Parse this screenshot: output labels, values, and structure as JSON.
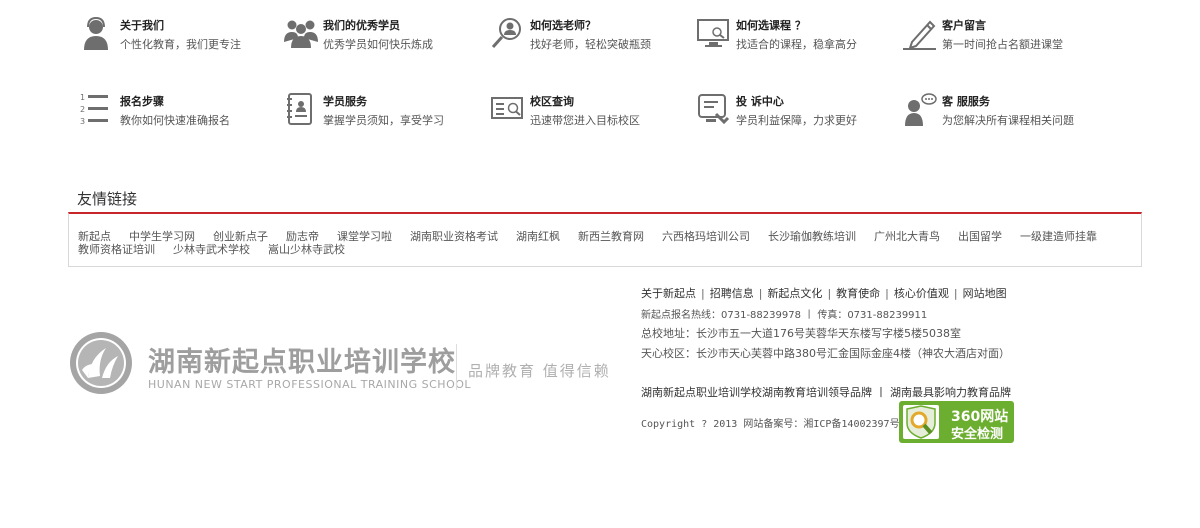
{
  "features": [
    {
      "title": "关于我们",
      "desc": "个性化教育，我们更专注",
      "icon": "person-icon"
    },
    {
      "title": "我们的优秀学员",
      "desc": "优秀学员如何快乐炼成",
      "icon": "group-icon"
    },
    {
      "title": "如何选老师？",
      "desc": "找好老师，轻松突破瓶颈",
      "icon": "teacher-search-icon"
    },
    {
      "title": "如何选课程 ？",
      "desc": "找适合的课程，稳拿高分",
      "icon": "monitor-icon"
    },
    {
      "title": "客户留言",
      "desc": "第一时间抢占名额进课堂",
      "icon": "pen-icon"
    },
    {
      "title": "报名步骤",
      "desc": "教你如何快速准确报名",
      "icon": "steps-list-icon"
    },
    {
      "title": "学员服务",
      "desc": "掌握学员须知，享受学习",
      "icon": "notebook-icon"
    },
    {
      "title": "校区查询",
      "desc": "迅速带您进入目标校区",
      "icon": "campus-search-icon"
    },
    {
      "title": "投 诉中心",
      "desc": "学员利益保障，力求更好",
      "icon": "complaint-icon"
    },
    {
      "title": "客 服服务",
      "desc": "为您解决所有课程相关问题",
      "icon": "customer-service-icon"
    }
  ],
  "friend_links": {
    "title": "友情链接",
    "items": [
      "新起点",
      "中学生学习网",
      "创业新点子",
      "励志帝",
      "课堂学习啦",
      "湖南职业资格考试",
      "湖南红枫",
      "新西兰教育网",
      "六西格玛培训公司",
      "长沙瑜伽教练培训",
      "广州北大青鸟",
      "出国留学",
      "一级建造师挂靠",
      "教师资格证培训",
      "少林寺武术学校",
      "嵩山少林寺武校"
    ]
  },
  "logo": {
    "cn": "湖南新起点职业培训学校",
    "en": "HUNAN NEW START PROFESSIONAL TRAINING SCHOOL",
    "slogan": "品牌教育 值得信赖"
  },
  "footer": {
    "nav": [
      "关于新起点",
      "招聘信息",
      "新起点文化",
      "教育使命",
      "核心价值观",
      "网站地图"
    ],
    "hotline": "新起点报名热线：0731-88239978 丨 传真：0731-88239911",
    "main_campus": "总校地址：长沙市五一大道176号芙蓉华天东楼写字楼5楼5038室",
    "tianxin_campus": "天心校区：长沙市天心芙蓉中路380号汇金国际金座4楼（神农大酒店对面）",
    "brand_line": "湖南新起点职业培训学校湖南教育培训领导品牌 丨 湖南最具影响力教育品牌",
    "copyright": "Copyright ? 2013 网站备案号：湘ICP备14002397号-1",
    "badge_line1": "360网站",
    "badge_line2": "安全检测"
  },
  "colors": {
    "accent_red": "#c9262c",
    "icon_gray": "#6e6e6e",
    "badge_green": "#6cae2f"
  }
}
